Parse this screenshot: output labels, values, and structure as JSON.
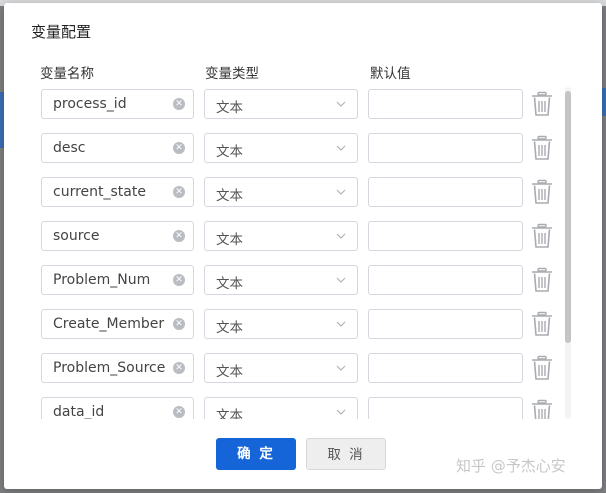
{
  "dialog": {
    "title": "变量配置"
  },
  "columns": {
    "name": "变量名称",
    "type": "变量类型",
    "default": "默认值"
  },
  "rows": [
    {
      "name": "process_id",
      "type": "文本",
      "default": ""
    },
    {
      "name": "desc",
      "type": "文本",
      "default": ""
    },
    {
      "name": "current_state",
      "type": "文本",
      "default": ""
    },
    {
      "name": "source",
      "type": "文本",
      "default": ""
    },
    {
      "name": "Problem_Num",
      "type": "文本",
      "default": ""
    },
    {
      "name": "Create_Member",
      "type": "文本",
      "default": ""
    },
    {
      "name": "Problem_Source",
      "type": "文本",
      "default": ""
    },
    {
      "name": "data_id",
      "type": "文本",
      "default": ""
    }
  ],
  "buttons": {
    "ok": "确 定",
    "cancel": "取 消"
  },
  "watermark": "知乎 @予杰心安",
  "colors": {
    "primary": "#1565d8",
    "border": "#d4d7dd"
  }
}
